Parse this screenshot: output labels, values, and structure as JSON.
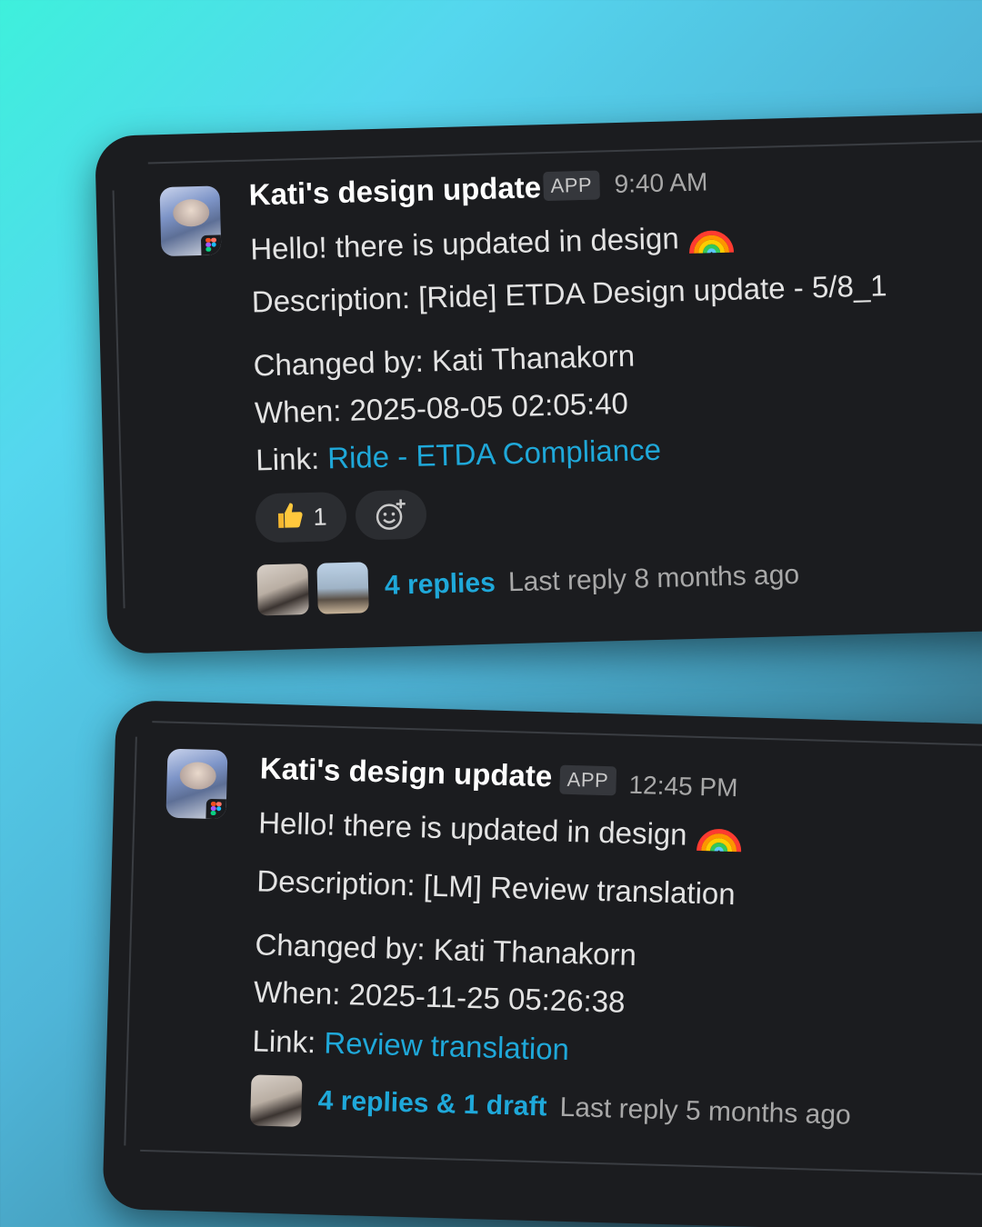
{
  "messages": [
    {
      "sender": "Kati's design update",
      "badge": "APP",
      "time": "9:40 AM",
      "greeting": "Hello! there is updated in design",
      "greeting_emoji": "rainbow",
      "description": "Description: [Ride] ETDA Design update - 5/8_1",
      "changed_by": "Changed by: Kati Thanakorn",
      "when": "When: 2025-08-05 02:05:40",
      "link_label": "Link: ",
      "link_text": "Ride - ETDA Compliance",
      "reaction": {
        "emoji": "thumbs-up",
        "count": "1"
      },
      "add_reaction_icon": "add-reaction-icon",
      "replies": "4 replies",
      "last_reply": "Last reply 8 months ago"
    },
    {
      "sender": "Kati's design update",
      "badge": "APP",
      "time": "12:45 PM",
      "greeting": "Hello! there is updated in design",
      "greeting_emoji": "rainbow",
      "description": "Description: [LM] Review translation",
      "changed_by": "Changed by: Kati Thanakorn",
      "when": "When: 2025-11-25 05:26:38",
      "link_label": "Link: ",
      "link_text": "Review translation",
      "replies": "4 replies & 1 draft",
      "last_reply": "Last reply 5 months ago"
    }
  ],
  "colors": {
    "card_bg": "#1b1c1f",
    "link": "#1fa8d9",
    "muted": "#a8a8a8",
    "text": "#e3e3e3"
  }
}
